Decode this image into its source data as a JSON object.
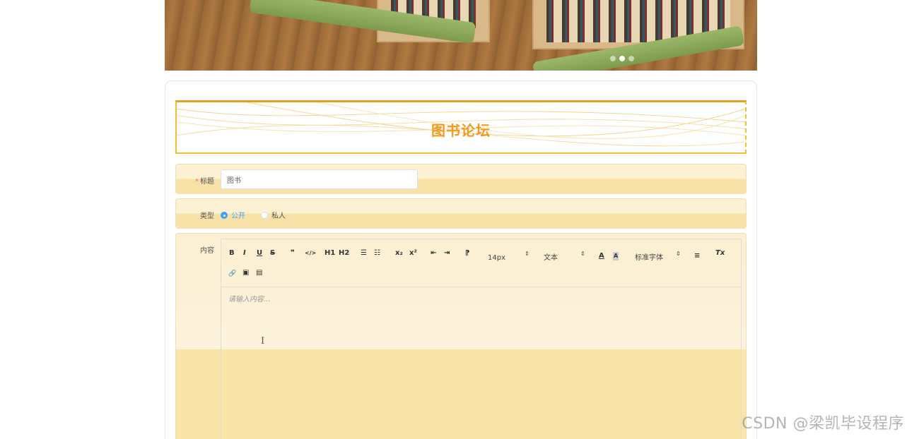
{
  "banner": {
    "carousel_dots": [
      {
        "active": false
      },
      {
        "active": true
      },
      {
        "active": false
      }
    ]
  },
  "form": {
    "heading": "图书论坛",
    "title_field": {
      "required_mark": "*",
      "label": "标题",
      "value": "图书"
    },
    "type_field": {
      "label": "类型",
      "options": [
        "公开",
        "私人"
      ],
      "selected": "公开"
    },
    "content_field": {
      "label": "内容",
      "placeholder": "请输入内容...",
      "toolbar": {
        "bold": "B",
        "italic": "I",
        "underline": "U",
        "strike": "S",
        "blockquote": "❞",
        "code": "</>",
        "h1": "H1",
        "h2": "H2",
        "ordered_list": "☰",
        "bullet_list": "☷",
        "subscript": "x₂",
        "superscript": "x²",
        "outdent": "⇤",
        "indent": "⇥",
        "direction": "⁋",
        "size_select": "14px",
        "header_select": "文本",
        "font_select": "标准字体",
        "select_arrow": "⇕",
        "color": "A",
        "background": "A",
        "align": "≡",
        "clean": "Tx",
        "link": "🔗",
        "image": "▣",
        "video": "▤"
      }
    }
  },
  "watermark": "CSDN @梁凯毕设程序"
}
